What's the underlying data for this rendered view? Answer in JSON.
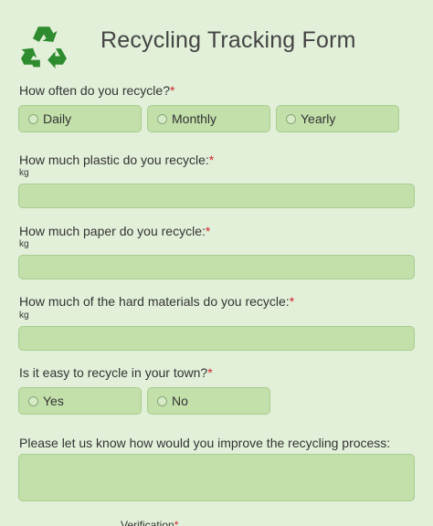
{
  "form": {
    "title": "Recycling Tracking Form",
    "logo_icon": "recycle-icon",
    "logo_color": "#2e8b2e",
    "accent_required_color": "#d0262b",
    "field_background": "#c3e0ab",
    "page_background": "#e2f0d9"
  },
  "q1": {
    "label": "How often do you recycle?",
    "required_mark": "*",
    "options": [
      "Daily",
      "Monthly",
      "Yearly"
    ]
  },
  "q2": {
    "label": "How much plastic do you recycle:",
    "required_mark": "*",
    "unit": "kg",
    "value": ""
  },
  "q3": {
    "label": "How much paper do you recycle:",
    "required_mark": "*",
    "unit": "kg",
    "value": ""
  },
  "q4": {
    "label": "How much of the hard materials do you recycle:",
    "required_mark": "*",
    "unit": "kg",
    "value": ""
  },
  "q5": {
    "label": "Is it easy to recycle in your town?",
    "required_mark": "*",
    "options": [
      "Yes",
      "No"
    ]
  },
  "q6": {
    "label": "Please let us know how would you improve the recycling process:",
    "value": ""
  },
  "verification": {
    "label": "Verification",
    "required_mark": "*"
  }
}
